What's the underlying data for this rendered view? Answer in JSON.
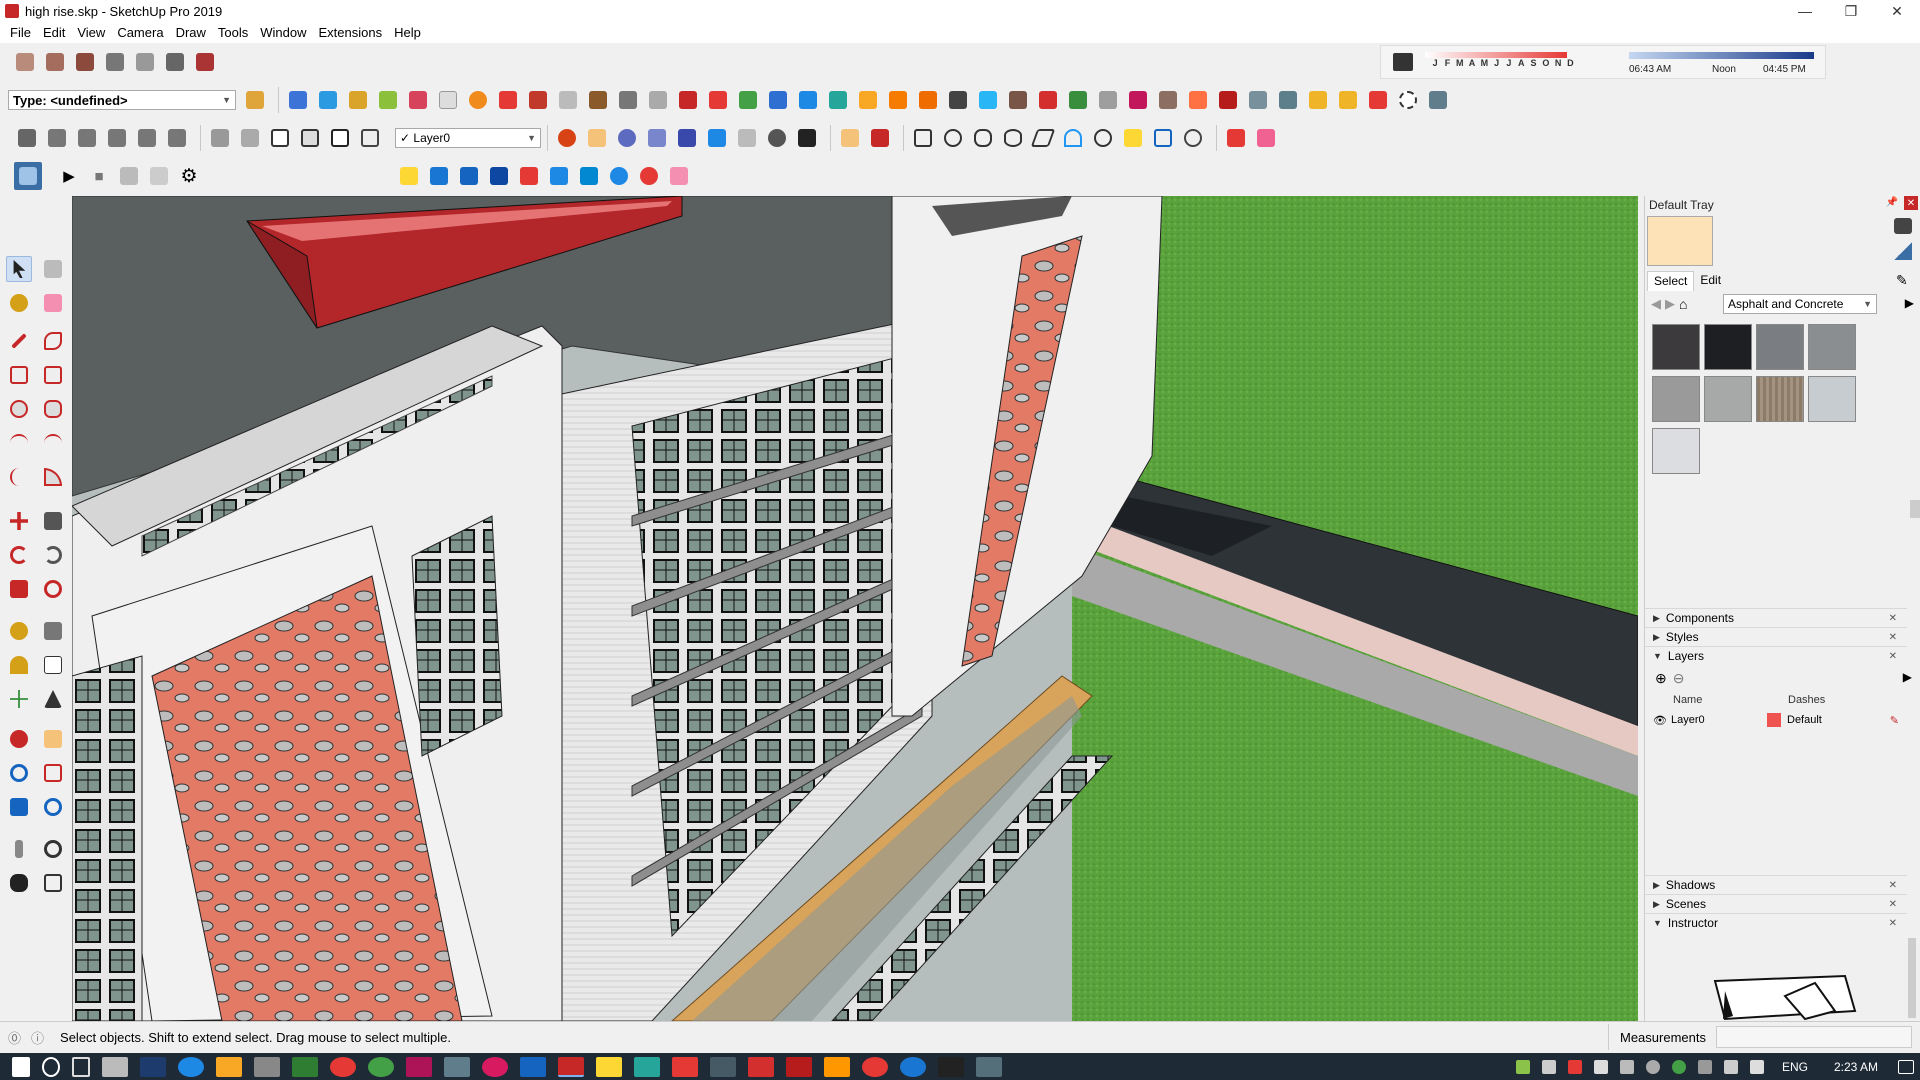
{
  "window": {
    "title": "high rise.skp - SketchUp Pro 2019",
    "minimize": "—",
    "maximize": "❐",
    "close": "✕"
  },
  "menu": [
    "File",
    "Edit",
    "View",
    "Camera",
    "Draw",
    "Tools",
    "Window",
    "Extensions",
    "Help"
  ],
  "toolbar": {
    "type_select": "Type: <undefined>",
    "layer_select": "Layer0",
    "play": "▶",
    "stop": "■",
    "settings": "⚙"
  },
  "shadow": {
    "months": [
      "J",
      "F",
      "M",
      "A",
      "M",
      "J",
      "J",
      "A",
      "S",
      "O",
      "N",
      "D"
    ],
    "time_start": "06:43 AM",
    "time_mid": "Noon",
    "time_end": "04:45 PM"
  },
  "tray": {
    "title": "Default Tray",
    "tabs": {
      "select": "Select",
      "edit": "Edit"
    },
    "collection": "Asphalt and Concrete",
    "panels": {
      "components": "Components",
      "styles": "Styles",
      "layers": "Layers",
      "shadows": "Shadows",
      "scenes": "Scenes",
      "instructor": "Instructor"
    },
    "layers_table": {
      "col_name": "Name",
      "col_dashes": "Dashes",
      "row_name": "Layer0",
      "row_dashes": "Default"
    }
  },
  "status": {
    "text": "Select objects. Shift to extend select. Drag mouse to select multiple.",
    "measurements_label": "Measurements"
  },
  "taskbar": {
    "lang": "ENG",
    "time": "2:23 AM"
  },
  "colors": {
    "accent_red": "#c0392b",
    "facade": "#e27a66",
    "grass": "#55a23a",
    "road": "#2e3338",
    "wood": "#d8a35a"
  }
}
